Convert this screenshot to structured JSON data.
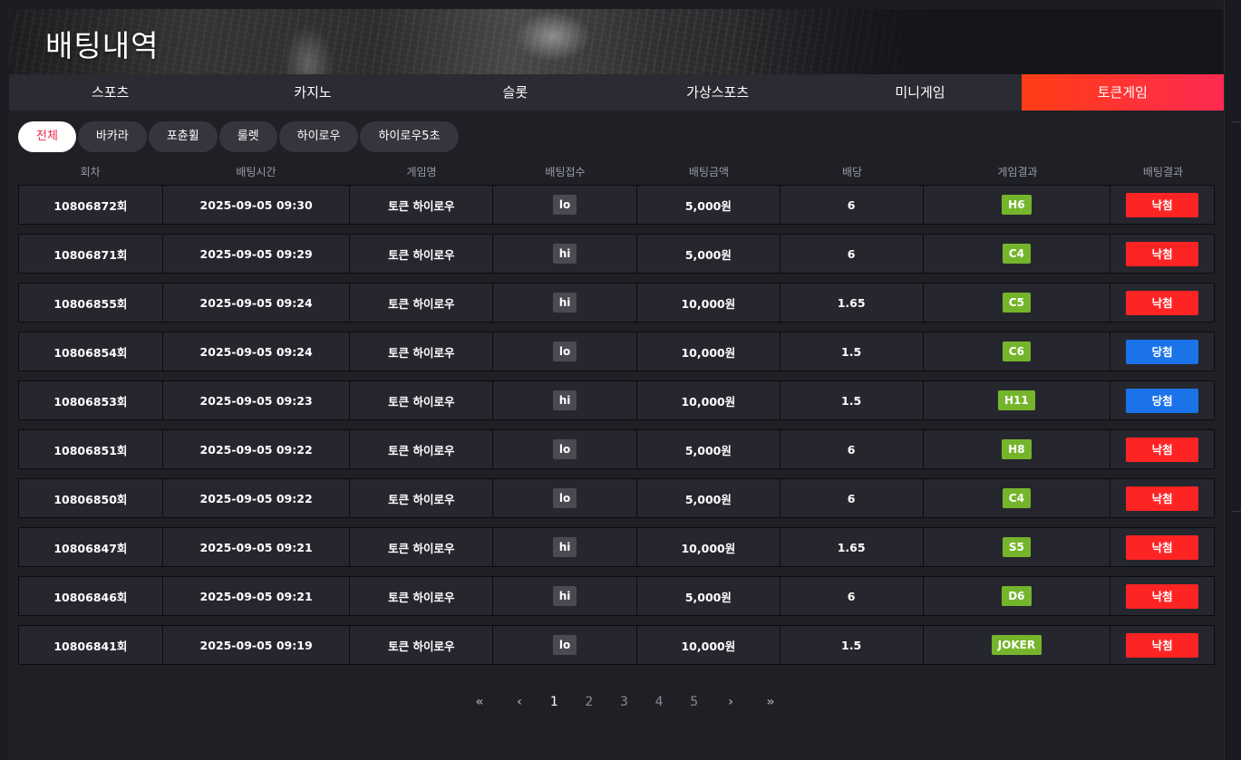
{
  "title": "배팅내역",
  "main_tabs": [
    {
      "label": "스포츠",
      "active": false
    },
    {
      "label": "카지노",
      "active": false
    },
    {
      "label": "슬롯",
      "active": false
    },
    {
      "label": "가상스포츠",
      "active": false
    },
    {
      "label": "미니게임",
      "active": false
    },
    {
      "label": "토큰게임",
      "active": true
    }
  ],
  "sub_tabs": [
    {
      "label": "전체",
      "active": true
    },
    {
      "label": "바카라",
      "active": false
    },
    {
      "label": "포츈휠",
      "active": false
    },
    {
      "label": "룰렛",
      "active": false
    },
    {
      "label": "하이로우",
      "active": false
    },
    {
      "label": "하이로우5초",
      "active": false
    }
  ],
  "columns": [
    "회차",
    "배팅시간",
    "게임명",
    "배팅접수",
    "배팅금액",
    "배당",
    "게임결과",
    "배팅결과"
  ],
  "rows": [
    {
      "round": "10806872회",
      "time": "2025-09-05 09:30",
      "game": "토큰 하이로우",
      "pick": "lo",
      "amount": "5,000원",
      "odds": "6",
      "result": "H6",
      "outcome": "낙첨"
    },
    {
      "round": "10806871회",
      "time": "2025-09-05 09:29",
      "game": "토큰 하이로우",
      "pick": "hi",
      "amount": "5,000원",
      "odds": "6",
      "result": "C4",
      "outcome": "낙첨"
    },
    {
      "round": "10806855회",
      "time": "2025-09-05 09:24",
      "game": "토큰 하이로우",
      "pick": "hi",
      "amount": "10,000원",
      "odds": "1.65",
      "result": "C5",
      "outcome": "낙첨"
    },
    {
      "round": "10806854회",
      "time": "2025-09-05 09:24",
      "game": "토큰 하이로우",
      "pick": "lo",
      "amount": "10,000원",
      "odds": "1.5",
      "result": "C6",
      "outcome": "당첨"
    },
    {
      "round": "10806853회",
      "time": "2025-09-05 09:23",
      "game": "토큰 하이로우",
      "pick": "hi",
      "amount": "10,000원",
      "odds": "1.5",
      "result": "H11",
      "outcome": "당첨"
    },
    {
      "round": "10806851회",
      "time": "2025-09-05 09:22",
      "game": "토큰 하이로우",
      "pick": "lo",
      "amount": "5,000원",
      "odds": "6",
      "result": "H8",
      "outcome": "낙첨"
    },
    {
      "round": "10806850회",
      "time": "2025-09-05 09:22",
      "game": "토큰 하이로우",
      "pick": "lo",
      "amount": "5,000원",
      "odds": "6",
      "result": "C4",
      "outcome": "낙첨"
    },
    {
      "round": "10806847회",
      "time": "2025-09-05 09:21",
      "game": "토큰 하이로우",
      "pick": "hi",
      "amount": "10,000원",
      "odds": "1.65",
      "result": "S5",
      "outcome": "낙첨"
    },
    {
      "round": "10806846회",
      "time": "2025-09-05 09:21",
      "game": "토큰 하이로우",
      "pick": "hi",
      "amount": "5,000원",
      "odds": "6",
      "result": "D6",
      "outcome": "낙첨"
    },
    {
      "round": "10806841회",
      "time": "2025-09-05 09:19",
      "game": "토큰 하이로우",
      "pick": "lo",
      "amount": "10,000원",
      "odds": "1.5",
      "result": "JOKER",
      "outcome": "낙첨"
    }
  ],
  "outcome_colors": {
    "낙첨": "#ff2424",
    "당첨": "#1a73e8"
  },
  "colors": {
    "accent_start": "#ff3d14",
    "accent_end": "#ff2a52",
    "result_badge": "#75b52c",
    "background": "#1f2026"
  },
  "pagination": {
    "first_icon": "double-chevron-left-icon",
    "prev_icon": "chevron-left-icon",
    "next_icon": "chevron-right-icon",
    "last_icon": "double-chevron-right-icon",
    "first": "«",
    "prev": "‹",
    "next": "›",
    "last": "»",
    "pages": [
      "1",
      "2",
      "3",
      "4",
      "5"
    ],
    "current": "1"
  }
}
